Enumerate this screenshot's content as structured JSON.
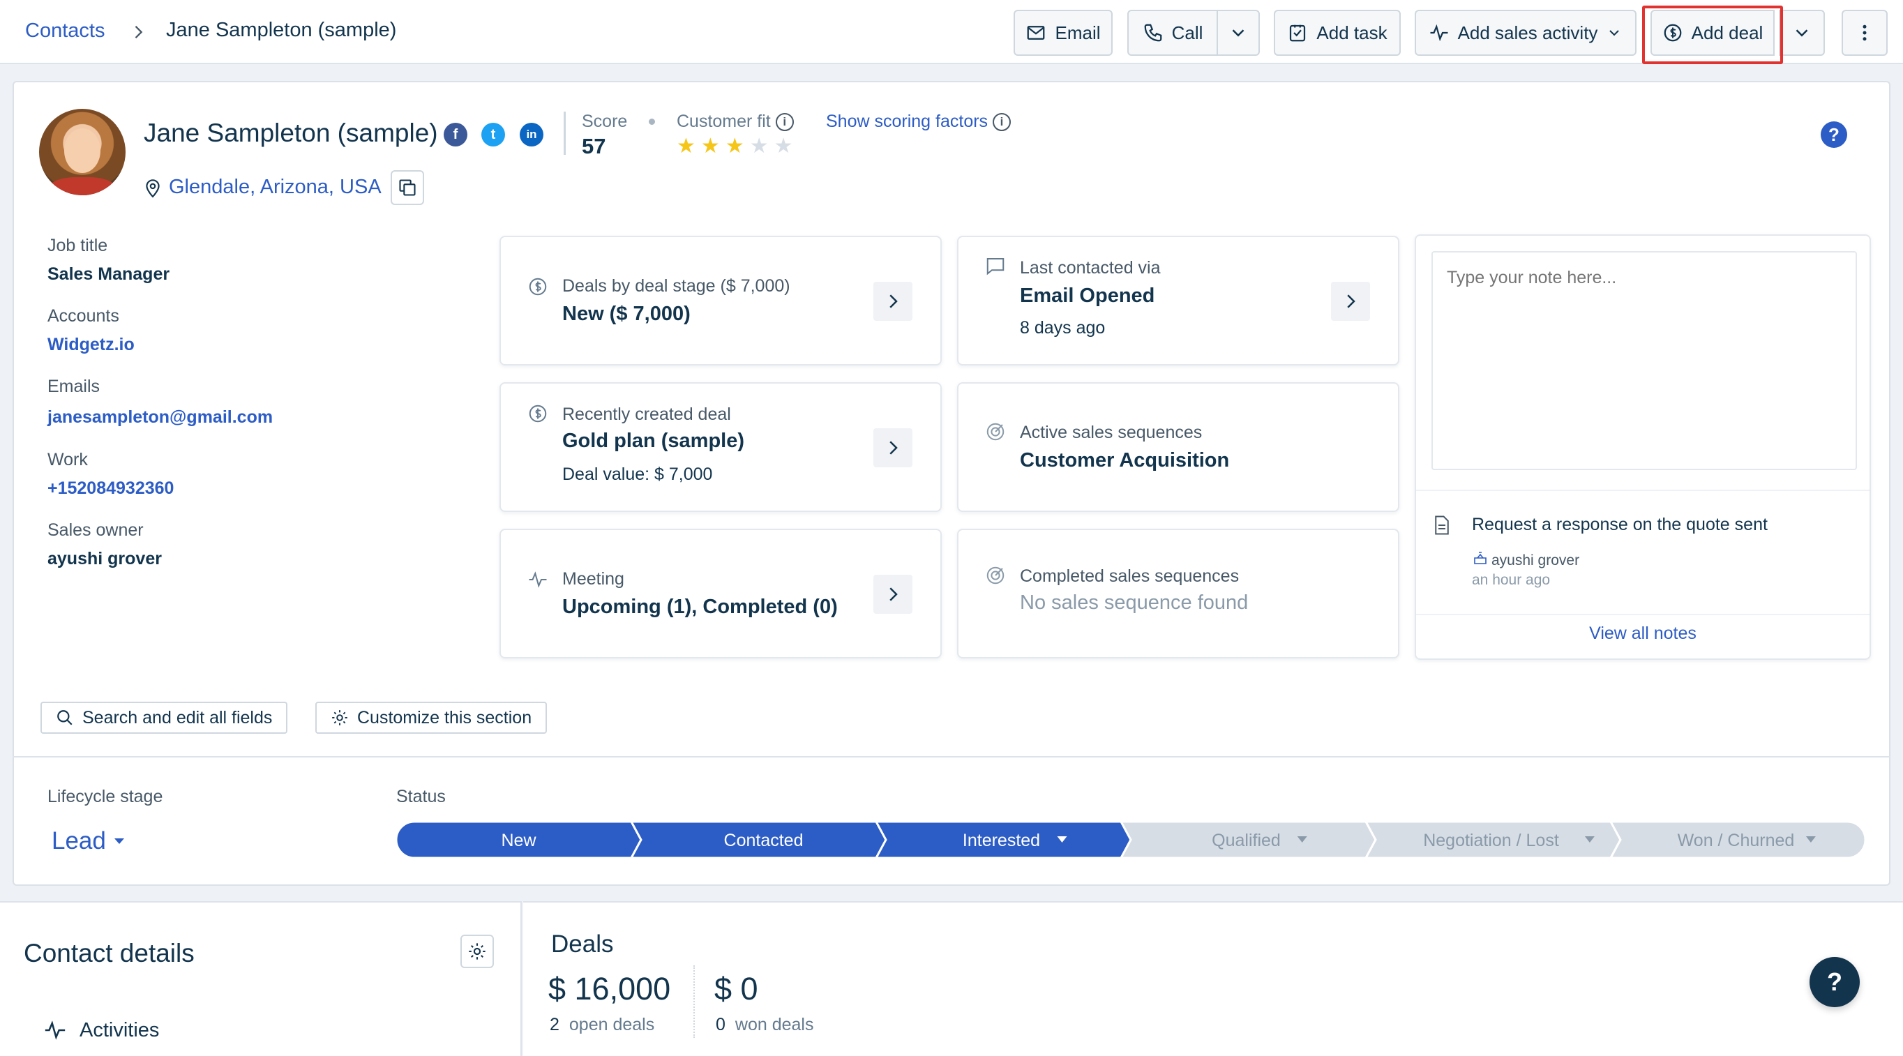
{
  "breadcrumb": {
    "parent": "Contacts",
    "current": "Jane Sampleton (sample)"
  },
  "toolbar": {
    "email": "Email",
    "call": "Call",
    "add_task": "Add task",
    "add_sales_activity": "Add sales activity",
    "add_deal": "Add deal"
  },
  "contact": {
    "name": "Jane Sampleton (sample)",
    "location": "Glendale, Arizona, USA",
    "score_label": "Score",
    "score": "57",
    "customer_fit_label": "Customer fit",
    "customer_fit_stars": 3,
    "customer_fit_max": 5,
    "show_scoring": "Show scoring factors",
    "social": {
      "facebook": "f",
      "twitter": "t",
      "linkedin": "in"
    }
  },
  "fields": {
    "job_title_label": "Job title",
    "job_title": "Sales Manager",
    "accounts_label": "Accounts",
    "accounts": "Widgetz.io",
    "emails_label": "Emails",
    "email": "janesampleton@gmail.com",
    "work_label": "Work",
    "work": "+152084932360",
    "owner_label": "Sales owner",
    "owner": "ayushi grover"
  },
  "widgets": {
    "deals_stage": {
      "label": "Deals by deal stage ($ 7,000)",
      "value": "New ($ 7,000)"
    },
    "last_contacted": {
      "label": "Last contacted via",
      "value": "Email Opened",
      "sub": "8 days ago"
    },
    "recent_deal": {
      "label": "Recently created deal",
      "value": "Gold plan (sample)",
      "sub": "Deal value: $ 7,000"
    },
    "active_seq": {
      "label": "Active sales sequences",
      "value": "Customer Acquisition"
    },
    "meeting": {
      "label": "Meeting",
      "value": "Upcoming (1), Completed (0)"
    },
    "completed_seq": {
      "label": "Completed sales sequences",
      "value": "No sales sequence found"
    }
  },
  "notes": {
    "placeholder": "Type your note here...",
    "item_title": "Request a response on the quote sent",
    "item_author": "ayushi grover",
    "item_time": "an hour ago",
    "view_all": "View all notes"
  },
  "actions": {
    "search_fields": "Search and edit all fields",
    "customize": "Customize this section"
  },
  "lifecycle": {
    "label": "Lifecycle stage",
    "value": "Lead"
  },
  "status": {
    "label": "Status",
    "stages": [
      "New",
      "Contacted",
      "Interested",
      "Qualified",
      "Negotiation / Lost",
      "Won / Churned"
    ],
    "active_count": 3
  },
  "contact_details": {
    "title": "Contact details",
    "activities": "Activities"
  },
  "deals": {
    "title": "Deals",
    "open_amount": "$ 16,000",
    "open_count": "2",
    "open_label": "open deals",
    "won_amount": "$ 0",
    "won_count": "0",
    "won_label": "won deals"
  },
  "colors": {
    "accent": "#2c5cc5",
    "status_active": "#2c5cc5",
    "status_inactive": "#d6dde5",
    "highlight": "#e0322f",
    "star_on": "#f5c518",
    "star_off": "#d6dde5"
  }
}
